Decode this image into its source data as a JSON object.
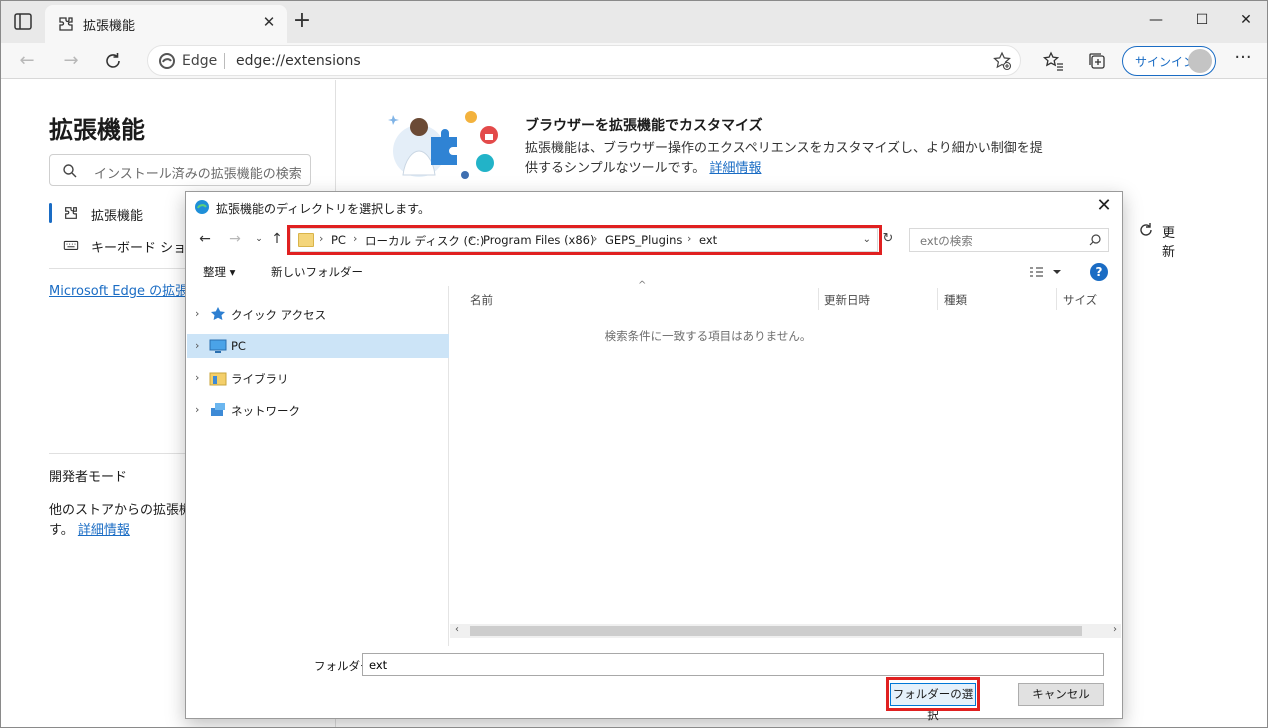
{
  "browser": {
    "tab_title": "拡張機能",
    "address_prefix": "Edge",
    "url": "edge://extensions",
    "signin_label": "サインイン",
    "icons": [
      "tab-actions-icon",
      "extension-icon",
      "close-icon",
      "plus-icon",
      "minimize-icon",
      "maximize-icon",
      "window-close-icon",
      "back-arrow-icon",
      "forward-arrow-icon",
      "refresh-icon",
      "edge-logo-icon",
      "add-favorite-icon",
      "favorites-icon",
      "collections-icon",
      "avatar-icon",
      "more-icon"
    ]
  },
  "sidebar": {
    "title": "拡張機能",
    "search_placeholder": "インストール済みの拡張機能の検索",
    "items": [
      {
        "label": "拡張機能",
        "active": true
      },
      {
        "label": "キーボード ショートカット",
        "active": false
      }
    ],
    "link": "Microsoft Edge の拡張機能",
    "dev_mode_label": "開発者モード",
    "dev_desc": "他のストアからの拡張機能を許可します。",
    "dev_desc_head": "他のストアからの拡張機能",
    "dev_desc_tail": "す。",
    "dev_link": "詳細情報"
  },
  "hero": {
    "title": "ブラウザーを拡張機能でカスタマイズ",
    "desc": "拡張機能は、ブラウザー操作のエクスペリエンスをカスタマイズし、より細かい制御を提供するシンプルなツールです。",
    "link": "詳細情報",
    "refresh_label": "更新"
  },
  "dialog": {
    "title": "拡張機能のディレクトリを選択します。",
    "breadcrumb": [
      "PC",
      "ローカル ディスク (C:)",
      "Program Files (x86)",
      "GEPS_Plugins",
      "ext"
    ],
    "search_placeholder": "extの検索",
    "organize_label": "整理",
    "new_folder_label": "新しいフォルダー",
    "tree": [
      {
        "label": "クイック アクセス",
        "icon": "star-icon",
        "selected": false
      },
      {
        "label": "PC",
        "icon": "computer-icon",
        "selected": true
      },
      {
        "label": "ライブラリ",
        "icon": "library-icon",
        "selected": false
      },
      {
        "label": "ネットワーク",
        "icon": "network-icon",
        "selected": false
      }
    ],
    "columns": [
      "名前",
      "更新日時",
      "種類",
      "サイズ"
    ],
    "empty_message": "検索条件に一致する項目はありません。",
    "folder_label": "フォルダー:",
    "folder_value": "ext",
    "select_button": "フォルダーの選択",
    "cancel_button": "キャンセル",
    "highlight_color": "#e02020"
  }
}
